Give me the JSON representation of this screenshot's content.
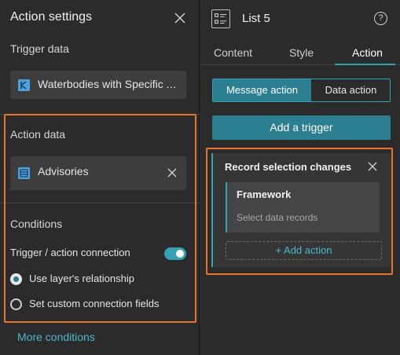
{
  "left_panel": {
    "title": "Action settings",
    "trigger_data": {
      "label": "Trigger data",
      "source": "Waterbodies with Specific Advisories"
    },
    "action_data": {
      "label": "Action data",
      "source": "Advisories"
    },
    "conditions": {
      "label": "Conditions",
      "connection_label": "Trigger / action connection",
      "connection_enabled": true,
      "options": [
        {
          "label": "Use layer's relationship",
          "selected": true
        },
        {
          "label": "Set custom connection fields",
          "selected": false
        }
      ]
    },
    "more_conditions": "More conditions"
  },
  "right_panel": {
    "title": "List 5",
    "help": "?",
    "tabs": [
      {
        "label": "Content",
        "active": false
      },
      {
        "label": "Style",
        "active": false
      },
      {
        "label": "Action",
        "active": true
      }
    ],
    "segments": [
      {
        "label": "Message action",
        "active": true
      },
      {
        "label": "Data action",
        "active": false
      }
    ],
    "add_trigger": "Add a trigger",
    "trigger_card": {
      "title": "Record selection changes",
      "framework": {
        "title": "Framework",
        "subtitle": "Select data records"
      },
      "add_action": "+ Add action"
    }
  },
  "colors": {
    "accent": "#35a2b4",
    "accent_fill": "#2b7f91",
    "highlight": "#e8742a",
    "background": "#2b2b2b",
    "link": "#4cb8cb"
  }
}
